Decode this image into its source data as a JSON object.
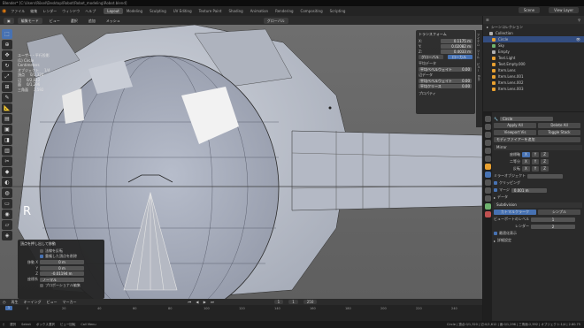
{
  "window": {
    "title": "Blender* [C:\\Users\\Rösel\\Desktop\\Robot\\Robot_modeling\\Robot.blend]"
  },
  "menu": [
    "ファイル",
    "編集",
    "レンダー",
    "ウィンドウ",
    "ヘルプ"
  ],
  "workspaces": [
    "Layout",
    "Modeling",
    "Sculpting",
    "UV Editing",
    "Texture Paint",
    "Shading",
    "Animation",
    "Rendering",
    "Compositing",
    "Scripting"
  ],
  "active_workspace": "Layout",
  "scene": {
    "label": "Scene",
    "view_layer": "View Layer"
  },
  "header": {
    "mode": "編集モード",
    "view": "ビュー",
    "select": "選択",
    "add": "追加",
    "mesh": "メッシュ",
    "transform": "グローバル"
  },
  "viewport": {
    "info": [
      "ユーザー・平行投影",
      "(1) Circle",
      "Centimeters"
    ],
    "stats": [
      {
        "label": "オブジェクト",
        "value": "1/4"
      },
      {
        "label": "頂点",
        "value": "0/1,320"
      },
      {
        "label": "辺",
        "value": "0/2,612"
      },
      {
        "label": "面",
        "value": "0/1,296"
      },
      {
        "label": "三角面",
        "value": "2,592"
      }
    ],
    "overlay_letter": "R"
  },
  "npanel": {
    "title": "トランスフォーム",
    "rows": [
      {
        "label": "X:",
        "value": "0.1175 m"
      },
      {
        "label": "Y:",
        "value": "0.02082 m"
      },
      {
        "label": "Z:",
        "value": "0.4033 m"
      }
    ],
    "buttons": [
      "グローバル",
      "ローカル"
    ],
    "sections": [
      {
        "title": "平均データ",
        "field": "平均ベベルウェイト",
        "value": "0.00"
      },
      {
        "title": "辺データ",
        "field": "平均ベベルウェイト",
        "value": "0.00"
      },
      {
        "title": "",
        "field": "平均クリース",
        "value": "0.00"
      }
    ],
    "properties_label": "プロパティ",
    "tabs": [
      "アイテム",
      "ツール",
      "ビュー",
      "Edit"
    ]
  },
  "operator_panel": {
    "title": "頂点を押し出して移動",
    "checks": [
      {
        "label": "法線を反転",
        "on": false
      },
      {
        "label": "重複した頂点を削除",
        "on": true
      }
    ],
    "fields": [
      {
        "label": "移動 X",
        "value": "0 m"
      },
      {
        "label": "Y",
        "value": "0 m"
      },
      {
        "label": "Z",
        "value": "-0.01194 m"
      }
    ],
    "orientation": {
      "label": "座標系",
      "value": "ノーマル"
    },
    "extra_check": "プロポーショナル編集"
  },
  "timeline": {
    "header": [
      "再生",
      "キーイング",
      "ビュー",
      "マーカー"
    ],
    "frames": [
      "0",
      "20",
      "40",
      "60",
      "80",
      "100",
      "120",
      "140",
      "160",
      "180",
      "200",
      "220",
      "240"
    ],
    "current": "1",
    "start": "1",
    "end": "250"
  },
  "statusbar": [
    "選択",
    "Select",
    "ボックス選択",
    "ビュー回転",
    "Call Menu",
    "Circle | 頂点:0/1,320 | 辺:0/2,612 | 面:0/1,296 | 三角面:2,592 | オブジェクト:1/4 | 2.80.75"
  ],
  "outliner": {
    "title": "シーンコレクション",
    "items": [
      {
        "name": "Collection",
        "color": "#b0b0b0",
        "selected": false
      },
      {
        "name": "Circle",
        "color": "#e8a030",
        "selected": true
      },
      {
        "name": "Sky",
        "color": "#6fb36f",
        "selected": false
      },
      {
        "name": "Empty",
        "color": "#b0b0b0",
        "selected": false
      },
      {
        "name": "Text.Light",
        "color": "#e8a030",
        "selected": false
      },
      {
        "name": "Text.Empty.000",
        "color": "#e8a030",
        "selected": false
      },
      {
        "name": "Item.Lens",
        "color": "#e8a030",
        "selected": false
      },
      {
        "name": "Item.Lens.001",
        "color": "#e8a030",
        "selected": false
      },
      {
        "name": "Item.Lens.002",
        "color": "#e8a030",
        "selected": false
      },
      {
        "name": "Item.Lens.003",
        "color": "#e8a030",
        "selected": false
      }
    ]
  },
  "properties": {
    "object_name": "Circle",
    "apply": {
      "apply_all": "Apply All",
      "delete_all": "Delete All",
      "viewport_vis": "Viewport Vis",
      "toggle_stack": "Toggle Stack"
    },
    "add_modifier": "モディファイアーを追加",
    "mirror": {
      "name": "Mirror",
      "axis_label": "座標軸",
      "bisect_label": "二等分",
      "flip_label": "反転",
      "axes": [
        "X",
        "Y",
        "Z"
      ],
      "mirror_object": "ミラーオブジェクト",
      "clipping": "クリッピング",
      "merge": "マージ",
      "merge_value": "0.001 m",
      "data": "データ"
    },
    "subsurf": {
      "name": "Subdivision",
      "catmull": "カトマルクラーク",
      "simple": "シンプル",
      "viewport_label": "ビューポートのレベル",
      "render_label": "レンダー",
      "viewport": "1",
      "render": "2",
      "optimal": "最適化表示",
      "advanced": "詳細設定"
    }
  }
}
